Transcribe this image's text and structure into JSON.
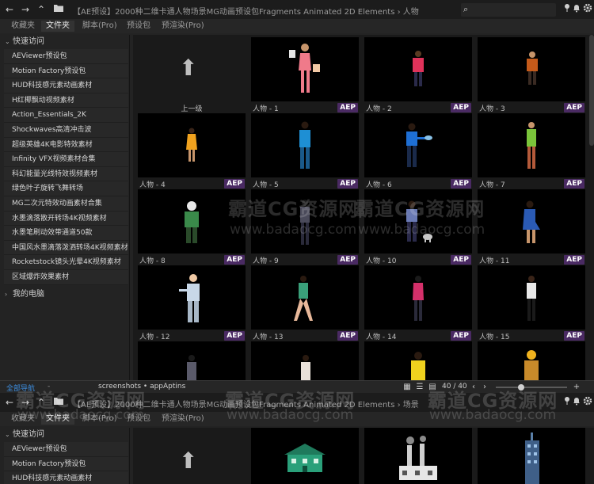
{
  "top_panel": {
    "titlebar": {
      "path": "【AE预设】2000种二维卡通人物场景MG动画预设包Fragments Animated 2D Elements  ›  人物",
      "search_placeholder": ""
    },
    "tabs": [
      {
        "label": "收藏夹",
        "active": false
      },
      {
        "label": "文件夹",
        "active": true
      },
      {
        "label": "脚本(Pro)",
        "active": false
      },
      {
        "label": "预设包",
        "active": false
      },
      {
        "label": "预渲染(Pro)",
        "active": false
      }
    ],
    "sidebar": {
      "quick_access": "快速访问",
      "items": [
        "AEViewer预设包",
        "Motion Factory预设包",
        "HUD科技感元素动画素材",
        "H红椰飘动视频素材",
        "Action_Essentials_2K",
        "Shockwaves高清冲击波",
        "超级英雄4K电影特效素材",
        "Infinity VFX视频素材合集",
        "科幻能量光线特效视频素材",
        "绿色叶子旋转飞舞转场",
        "MG二次元特效动画素材合集",
        "水墨滴落散开转场4K视频素材",
        "水墨笔刷动效带通道50款",
        "中国风水墨滴落泼洒转场4K视频素材",
        "Rocketstock镜头光晕4K视频素材",
        "区域爆炸效果素材"
      ],
      "my_computer": "我的电脑"
    },
    "up_label": "上一级",
    "badge": "AEP",
    "tiles": [
      {
        "label": "人物 - 1"
      },
      {
        "label": "人物 - 2"
      },
      {
        "label": "人物 - 3"
      },
      {
        "label": "人物 - 4"
      },
      {
        "label": "人物 - 5"
      },
      {
        "label": "人物 - 6"
      },
      {
        "label": "人物 - 7"
      },
      {
        "label": "人物 - 8"
      },
      {
        "label": "人物 - 9"
      },
      {
        "label": "人物 - 10"
      },
      {
        "label": "人物 - 11"
      },
      {
        "label": "人物 - 12"
      },
      {
        "label": "人物 - 13"
      },
      {
        "label": "人物 - 14"
      },
      {
        "label": "人物 - 15"
      }
    ]
  },
  "statusbar": {
    "link": "全部导航",
    "separator": "-",
    "file": "screenshots • appAptins",
    "page": "40 / 40"
  },
  "bottom_panel": {
    "titlebar": {
      "path": "【AE预设】2000种二维卡通人物场景MG动画预设包Fragments Animated 2D Elements  ›  场景"
    },
    "tabs": [
      {
        "label": "收藏夹",
        "active": false
      },
      {
        "label": "文件夹",
        "active": true
      },
      {
        "label": "脚本(Pro)",
        "active": false
      },
      {
        "label": "预设包",
        "active": false
      },
      {
        "label": "预渲染(Pro)",
        "active": false
      }
    ],
    "sidebar": {
      "quick_access": "快速访问",
      "items": [
        "AEViewer预设包",
        "Motion Factory预设包",
        "HUD科技感元素动画素材"
      ]
    }
  },
  "watermark": {
    "brand": "霸道CG资源网",
    "url": "www.badaocg.com"
  }
}
